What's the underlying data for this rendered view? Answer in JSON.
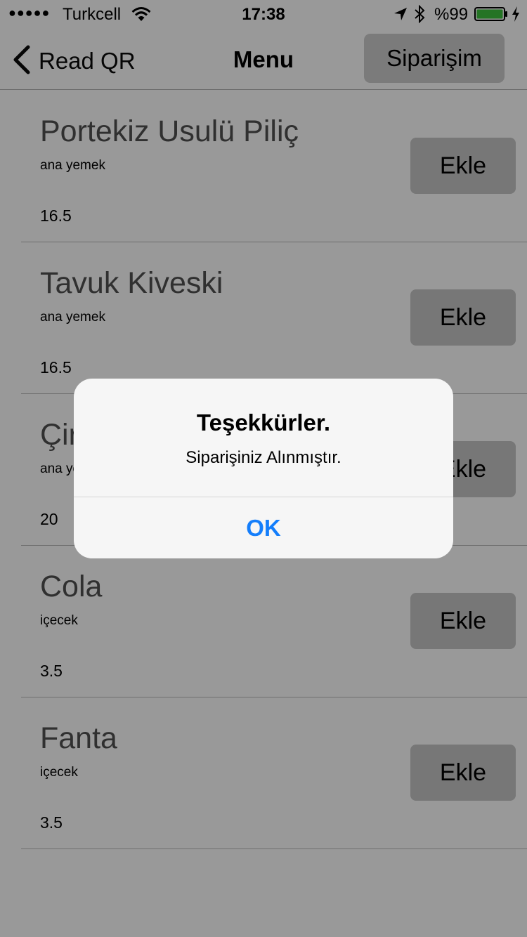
{
  "status_bar": {
    "signal": "●●●●●",
    "carrier": "Turkcell",
    "time": "17:38",
    "battery": "%99",
    "icons": [
      "wifi-icon",
      "location-icon",
      "bluetooth-icon",
      "battery-icon",
      "charging-icon"
    ],
    "battery_color": "#3cc23c"
  },
  "nav": {
    "back_label": "Read QR",
    "title": "Menu",
    "order_button": "Siparişim"
  },
  "menu": {
    "add_label": "Ekle",
    "items": [
      {
        "name": "Portekiz Usulü Piliç",
        "category": "ana yemek",
        "price": "16.5"
      },
      {
        "name": "Tavuk Kiveski",
        "category": "ana yemek",
        "price": "16.5"
      },
      {
        "name": "Çir",
        "category": "ana yemek",
        "price": "20"
      },
      {
        "name": "Cola",
        "category": "içecek",
        "price": "3.5"
      },
      {
        "name": "Fanta",
        "category": "içecek",
        "price": "3.5"
      }
    ]
  },
  "alert": {
    "title": "Teşekkürler.",
    "message": "Siparişiniz Alınmıştır.",
    "ok_label": "OK",
    "ok_color": "#147efb"
  }
}
